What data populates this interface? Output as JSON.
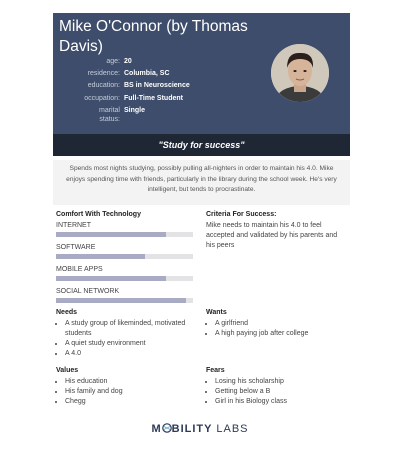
{
  "persona": {
    "name": "Mike O'Connor (by Thomas Davis)",
    "facts": [
      {
        "label": "age:",
        "value": "20"
      },
      {
        "label": "residence:",
        "value": "Columbia, SC"
      },
      {
        "label": "education:",
        "value": "BS in Neuroscience"
      },
      {
        "label": "occupation:",
        "value": "Full-Time Student"
      },
      {
        "label": "marital status:",
        "value": "Single"
      }
    ],
    "quote": "\"Study for success\"",
    "bio": "Spends most nights studying, possibly pulling all-nighters in order to maintain his 4.0. Mike enjoys spending time with friends, particularly in the library during the school week. He's very intelligent, but tends to procrastinate."
  },
  "technology": {
    "title": "Comfort With Technology",
    "items": [
      {
        "label": "INTERNET",
        "level": 0.8
      },
      {
        "label": "SOFTWARE",
        "level": 0.65
      },
      {
        "label": "MOBILE APPS",
        "level": 0.8
      },
      {
        "label": "SOCIAL NETWORK",
        "level": 0.95
      }
    ]
  },
  "criteria": {
    "title": "Criteria For Success:",
    "text": "Mike needs to maintain his 4.0 to feel accepted and validated by his parents and his peers"
  },
  "needs": {
    "title": "Needs",
    "items": [
      "A study group of likeminded, motivated students",
      "A quiet study environment",
      "A 4.0"
    ]
  },
  "wants": {
    "title": "Wants",
    "items": [
      "A girlfriend",
      "A high paying job after college"
    ]
  },
  "values": {
    "title": "Values",
    "items": [
      "His education",
      "His family and dog",
      "Chegg"
    ]
  },
  "fears": {
    "title": "Fears",
    "items": [
      "Losing his scholarship",
      "Getting below a B",
      "Girl in his Biology class"
    ]
  },
  "brand": {
    "part1": "M",
    "part2": "BILITY",
    "part3": "LABS",
    "color": "#2e3a57"
  },
  "colors": {
    "header": "#3e4d6b",
    "quote_bar": "#1f2735",
    "bar_fill": "#a9aac4"
  }
}
